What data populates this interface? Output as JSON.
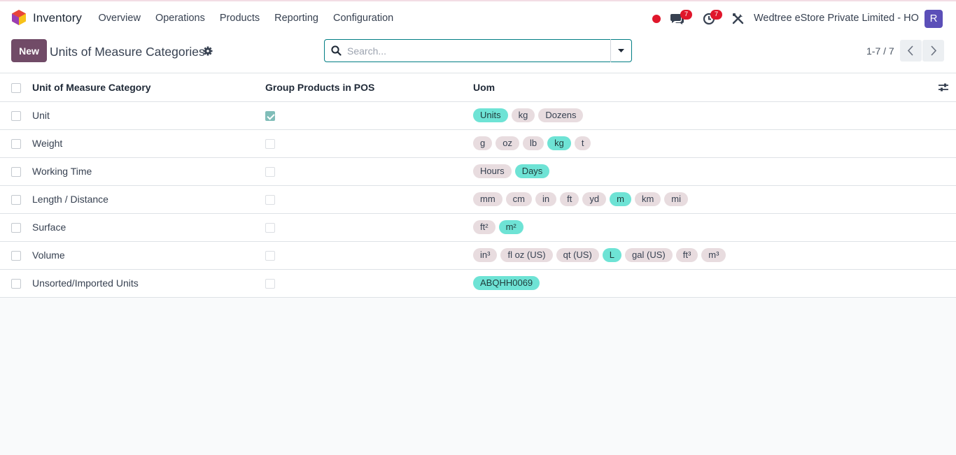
{
  "app": {
    "name": "Inventory"
  },
  "menu": [
    "Overview",
    "Operations",
    "Products",
    "Reporting",
    "Configuration"
  ],
  "systray": {
    "messages_count": "7",
    "activities_count": "7",
    "company": "Wedtree eStore Private Limited - HO",
    "avatar_letter": "R"
  },
  "control": {
    "new_label": "New",
    "title": "Units of Measure Categories",
    "search_placeholder": "Search...",
    "pager": "1-7 / 7"
  },
  "table": {
    "headers": {
      "name": "Unit of Measure Category",
      "pos": "Group Products in POS",
      "uom": "Uom"
    },
    "rows": [
      {
        "name": "Unit",
        "pos": true,
        "tags": [
          {
            "label": "Units",
            "ref": true
          },
          {
            "label": "kg",
            "ref": false
          },
          {
            "label": "Dozens",
            "ref": false
          }
        ]
      },
      {
        "name": "Weight",
        "pos": false,
        "tags": [
          {
            "label": "g",
            "ref": false
          },
          {
            "label": "oz",
            "ref": false
          },
          {
            "label": "lb",
            "ref": false
          },
          {
            "label": "kg",
            "ref": true
          },
          {
            "label": "t",
            "ref": false
          }
        ]
      },
      {
        "name": "Working Time",
        "pos": false,
        "tags": [
          {
            "label": "Hours",
            "ref": false
          },
          {
            "label": "Days",
            "ref": true
          }
        ]
      },
      {
        "name": "Length / Distance",
        "pos": false,
        "tags": [
          {
            "label": "mm",
            "ref": false
          },
          {
            "label": "cm",
            "ref": false
          },
          {
            "label": "in",
            "ref": false
          },
          {
            "label": "ft",
            "ref": false
          },
          {
            "label": "yd",
            "ref": false
          },
          {
            "label": "m",
            "ref": true
          },
          {
            "label": "km",
            "ref": false
          },
          {
            "label": "mi",
            "ref": false
          }
        ]
      },
      {
        "name": "Surface",
        "pos": false,
        "tags": [
          {
            "label": "ft²",
            "ref": false
          },
          {
            "label": "m²",
            "ref": true
          }
        ]
      },
      {
        "name": "Volume",
        "pos": false,
        "tags": [
          {
            "label": "in³",
            "ref": false
          },
          {
            "label": "fl oz (US)",
            "ref": false
          },
          {
            "label": "qt (US)",
            "ref": false
          },
          {
            "label": "L",
            "ref": true
          },
          {
            "label": "gal (US)",
            "ref": false
          },
          {
            "label": "ft³",
            "ref": false
          },
          {
            "label": "m³",
            "ref": false
          }
        ]
      },
      {
        "name": "Unsorted/Imported Units",
        "pos": false,
        "tags": [
          {
            "label": "ABQHH0069",
            "ref": true
          }
        ]
      }
    ]
  },
  "colors": {
    "brand": "#714b67",
    "tag_default": "#e8dcdf",
    "tag_reference": "#6ee3d5",
    "search_border": "#017e84",
    "badge": "#e0162b"
  }
}
